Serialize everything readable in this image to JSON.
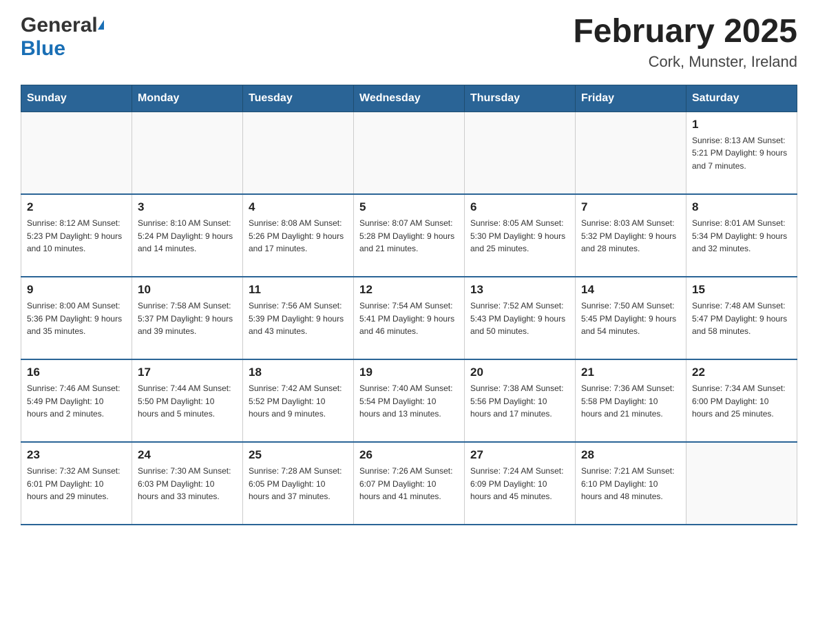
{
  "header": {
    "logo_general": "General",
    "logo_blue": "Blue",
    "month_title": "February 2025",
    "location": "Cork, Munster, Ireland"
  },
  "weekdays": [
    "Sunday",
    "Monday",
    "Tuesday",
    "Wednesday",
    "Thursday",
    "Friday",
    "Saturday"
  ],
  "weeks": [
    [
      {
        "day": "",
        "info": ""
      },
      {
        "day": "",
        "info": ""
      },
      {
        "day": "",
        "info": ""
      },
      {
        "day": "",
        "info": ""
      },
      {
        "day": "",
        "info": ""
      },
      {
        "day": "",
        "info": ""
      },
      {
        "day": "1",
        "info": "Sunrise: 8:13 AM\nSunset: 5:21 PM\nDaylight: 9 hours and 7 minutes."
      }
    ],
    [
      {
        "day": "2",
        "info": "Sunrise: 8:12 AM\nSunset: 5:23 PM\nDaylight: 9 hours and 10 minutes."
      },
      {
        "day": "3",
        "info": "Sunrise: 8:10 AM\nSunset: 5:24 PM\nDaylight: 9 hours and 14 minutes."
      },
      {
        "day": "4",
        "info": "Sunrise: 8:08 AM\nSunset: 5:26 PM\nDaylight: 9 hours and 17 minutes."
      },
      {
        "day": "5",
        "info": "Sunrise: 8:07 AM\nSunset: 5:28 PM\nDaylight: 9 hours and 21 minutes."
      },
      {
        "day": "6",
        "info": "Sunrise: 8:05 AM\nSunset: 5:30 PM\nDaylight: 9 hours and 25 minutes."
      },
      {
        "day": "7",
        "info": "Sunrise: 8:03 AM\nSunset: 5:32 PM\nDaylight: 9 hours and 28 minutes."
      },
      {
        "day": "8",
        "info": "Sunrise: 8:01 AM\nSunset: 5:34 PM\nDaylight: 9 hours and 32 minutes."
      }
    ],
    [
      {
        "day": "9",
        "info": "Sunrise: 8:00 AM\nSunset: 5:36 PM\nDaylight: 9 hours and 35 minutes."
      },
      {
        "day": "10",
        "info": "Sunrise: 7:58 AM\nSunset: 5:37 PM\nDaylight: 9 hours and 39 minutes."
      },
      {
        "day": "11",
        "info": "Sunrise: 7:56 AM\nSunset: 5:39 PM\nDaylight: 9 hours and 43 minutes."
      },
      {
        "day": "12",
        "info": "Sunrise: 7:54 AM\nSunset: 5:41 PM\nDaylight: 9 hours and 46 minutes."
      },
      {
        "day": "13",
        "info": "Sunrise: 7:52 AM\nSunset: 5:43 PM\nDaylight: 9 hours and 50 minutes."
      },
      {
        "day": "14",
        "info": "Sunrise: 7:50 AM\nSunset: 5:45 PM\nDaylight: 9 hours and 54 minutes."
      },
      {
        "day": "15",
        "info": "Sunrise: 7:48 AM\nSunset: 5:47 PM\nDaylight: 9 hours and 58 minutes."
      }
    ],
    [
      {
        "day": "16",
        "info": "Sunrise: 7:46 AM\nSunset: 5:49 PM\nDaylight: 10 hours and 2 minutes."
      },
      {
        "day": "17",
        "info": "Sunrise: 7:44 AM\nSunset: 5:50 PM\nDaylight: 10 hours and 5 minutes."
      },
      {
        "day": "18",
        "info": "Sunrise: 7:42 AM\nSunset: 5:52 PM\nDaylight: 10 hours and 9 minutes."
      },
      {
        "day": "19",
        "info": "Sunrise: 7:40 AM\nSunset: 5:54 PM\nDaylight: 10 hours and 13 minutes."
      },
      {
        "day": "20",
        "info": "Sunrise: 7:38 AM\nSunset: 5:56 PM\nDaylight: 10 hours and 17 minutes."
      },
      {
        "day": "21",
        "info": "Sunrise: 7:36 AM\nSunset: 5:58 PM\nDaylight: 10 hours and 21 minutes."
      },
      {
        "day": "22",
        "info": "Sunrise: 7:34 AM\nSunset: 6:00 PM\nDaylight: 10 hours and 25 minutes."
      }
    ],
    [
      {
        "day": "23",
        "info": "Sunrise: 7:32 AM\nSunset: 6:01 PM\nDaylight: 10 hours and 29 minutes."
      },
      {
        "day": "24",
        "info": "Sunrise: 7:30 AM\nSunset: 6:03 PM\nDaylight: 10 hours and 33 minutes."
      },
      {
        "day": "25",
        "info": "Sunrise: 7:28 AM\nSunset: 6:05 PM\nDaylight: 10 hours and 37 minutes."
      },
      {
        "day": "26",
        "info": "Sunrise: 7:26 AM\nSunset: 6:07 PM\nDaylight: 10 hours and 41 minutes."
      },
      {
        "day": "27",
        "info": "Sunrise: 7:24 AM\nSunset: 6:09 PM\nDaylight: 10 hours and 45 minutes."
      },
      {
        "day": "28",
        "info": "Sunrise: 7:21 AM\nSunset: 6:10 PM\nDaylight: 10 hours and 48 minutes."
      },
      {
        "day": "",
        "info": ""
      }
    ]
  ]
}
